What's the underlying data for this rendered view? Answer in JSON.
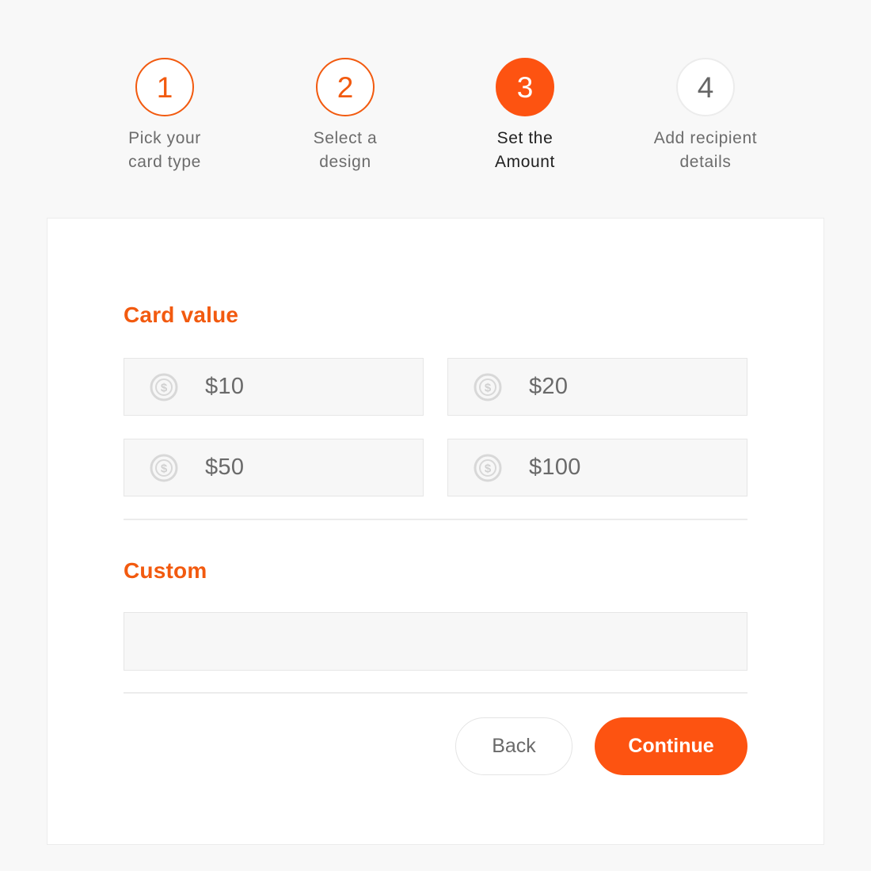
{
  "stepper": {
    "steps": [
      {
        "number": "1",
        "label": "Pick your\ncard type",
        "state": "done"
      },
      {
        "number": "2",
        "label": "Select a\ndesign",
        "state": "done"
      },
      {
        "number": "3",
        "label": "Set the\nAmount",
        "state": "active"
      },
      {
        "number": "4",
        "label": "Add recipient\ndetails",
        "state": "todo"
      }
    ]
  },
  "card_value": {
    "title": "Card value",
    "icon": "dollar-coin-icon",
    "options": [
      {
        "label": "$10"
      },
      {
        "label": "$20"
      },
      {
        "label": "$50"
      },
      {
        "label": "$100"
      }
    ]
  },
  "custom": {
    "title": "Custom",
    "value": "",
    "placeholder": ""
  },
  "actions": {
    "back_label": "Back",
    "continue_label": "Continue"
  },
  "colors": {
    "accent": "#fd5311",
    "accent_text": "#f25a0f",
    "background": "#f8f8f8",
    "panel": "#ffffff"
  }
}
